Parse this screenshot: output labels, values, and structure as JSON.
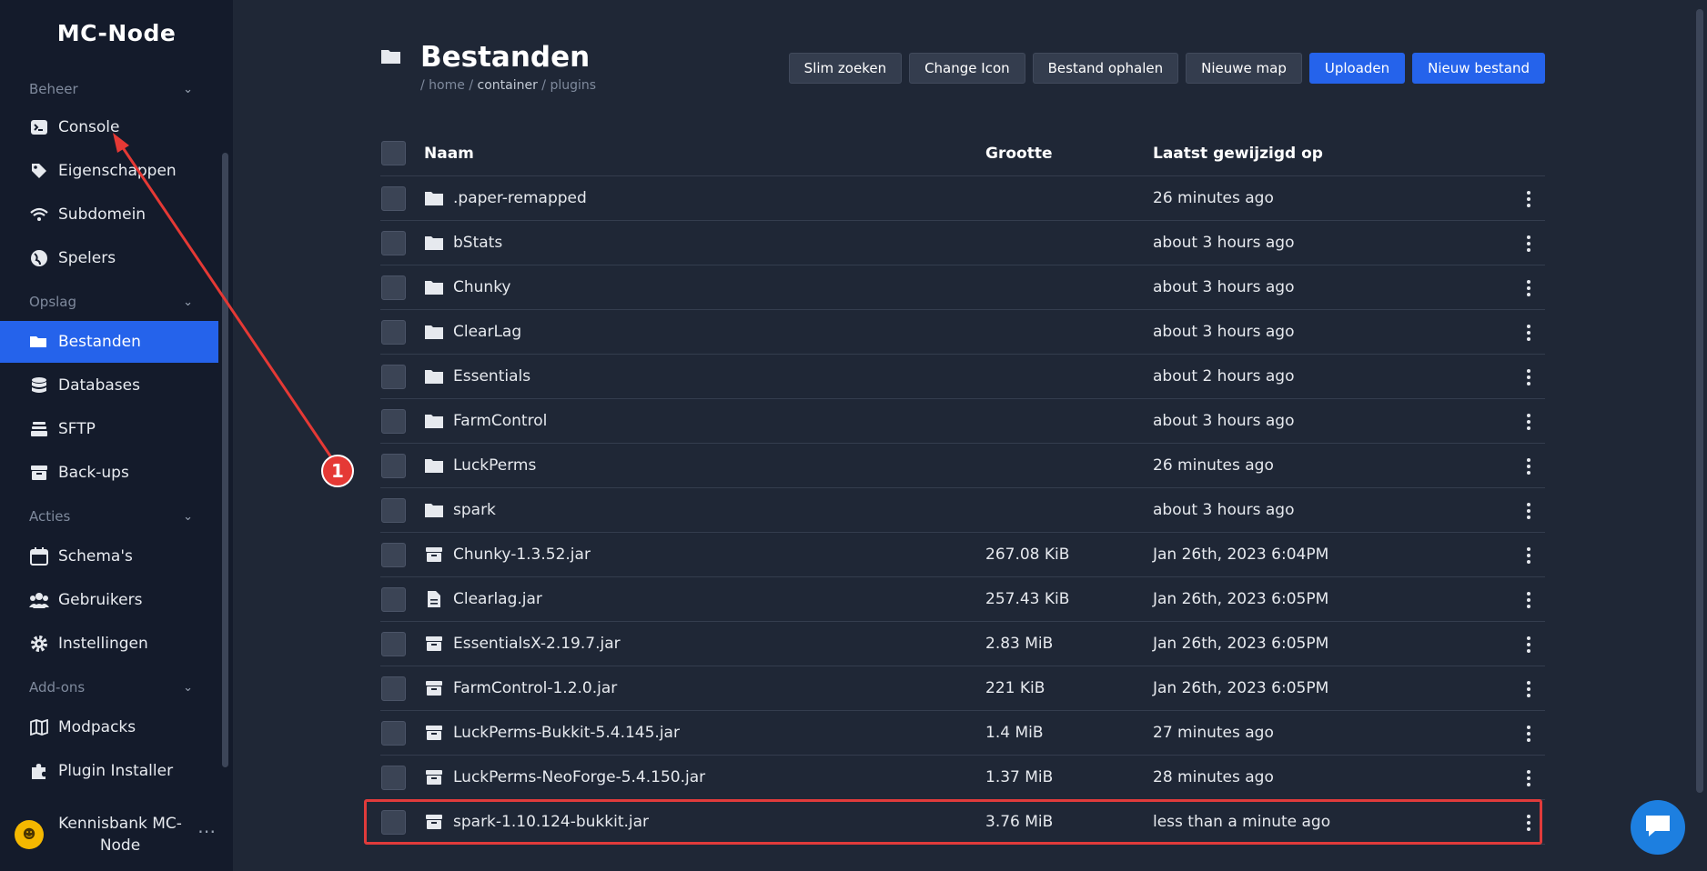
{
  "app": {
    "brand": "MC-Node"
  },
  "sidebar": {
    "sections": [
      {
        "label": "Beheer"
      },
      {
        "label": "Opslag"
      },
      {
        "label": "Acties"
      },
      {
        "label": "Add-ons"
      }
    ],
    "items": [
      {
        "label": "Console",
        "icon": "terminal-icon"
      },
      {
        "label": "Eigenschappen",
        "icon": "tag-icon"
      },
      {
        "label": "Subdomein",
        "icon": "wifi-icon"
      },
      {
        "label": "Spelers",
        "icon": "globe-icon"
      },
      {
        "label": "Bestanden",
        "icon": "folder-open-icon",
        "active": true
      },
      {
        "label": "Databases",
        "icon": "database-icon"
      },
      {
        "label": "SFTP",
        "icon": "layers-icon"
      },
      {
        "label": "Back-ups",
        "icon": "archive-icon"
      },
      {
        "label": "Schema's",
        "icon": "calendar-icon"
      },
      {
        "label": "Gebruikers",
        "icon": "users-icon"
      },
      {
        "label": "Instellingen",
        "icon": "gear-icon"
      },
      {
        "label": "Modpacks",
        "icon": "map-icon"
      },
      {
        "label": "Plugin Installer",
        "icon": "puzzle-icon"
      }
    ],
    "user": {
      "name": "Kennisbank MC-Node"
    }
  },
  "header": {
    "title": "Bestanden",
    "breadcrumb": {
      "sep1": "/",
      "home": "home",
      "sep2": "/",
      "container": "container",
      "sep3": "/",
      "plugins": "plugins"
    },
    "buttons": {
      "smart_search": "Slim zoeken",
      "change_icon": "Change Icon",
      "fetch_file": "Bestand ophalen",
      "new_folder": "Nieuwe map",
      "upload": "Uploaden",
      "new_file": "Nieuw bestand"
    }
  },
  "table": {
    "columns": {
      "name": "Naam",
      "size": "Grootte",
      "modified": "Laatst gewijzigd op"
    },
    "rows": [
      {
        "name": ".paper-remapped",
        "type": "folder",
        "size": "",
        "modified": "26 minutes ago"
      },
      {
        "name": "bStats",
        "type": "folder",
        "size": "",
        "modified": "about 3 hours ago"
      },
      {
        "name": "Chunky",
        "type": "folder",
        "size": "",
        "modified": "about 3 hours ago"
      },
      {
        "name": "ClearLag",
        "type": "folder",
        "size": "",
        "modified": "about 3 hours ago"
      },
      {
        "name": "Essentials",
        "type": "folder",
        "size": "",
        "modified": "about 2 hours ago"
      },
      {
        "name": "FarmControl",
        "type": "folder",
        "size": "",
        "modified": "about 3 hours ago"
      },
      {
        "name": "LuckPerms",
        "type": "folder",
        "size": "",
        "modified": "26 minutes ago"
      },
      {
        "name": "spark",
        "type": "folder",
        "size": "",
        "modified": "about 3 hours ago"
      },
      {
        "name": "Chunky-1.3.52.jar",
        "type": "archive",
        "size": "267.08 KiB",
        "modified": "Jan 26th, 2023 6:04PM"
      },
      {
        "name": "Clearlag.jar",
        "type": "file",
        "size": "257.43 KiB",
        "modified": "Jan 26th, 2023 6:05PM"
      },
      {
        "name": "EssentialsX-2.19.7.jar",
        "type": "archive",
        "size": "2.83 MiB",
        "modified": "Jan 26th, 2023 6:05PM"
      },
      {
        "name": "FarmControl-1.2.0.jar",
        "type": "archive",
        "size": "221 KiB",
        "modified": "Jan 26th, 2023 6:05PM"
      },
      {
        "name": "LuckPerms-Bukkit-5.4.145.jar",
        "type": "archive",
        "size": "1.4 MiB",
        "modified": "27 minutes ago"
      },
      {
        "name": "LuckPerms-NeoForge-5.4.150.jar",
        "type": "archive",
        "size": "1.37 MiB",
        "modified": "28 minutes ago"
      },
      {
        "name": "spark-1.10.124-bukkit.jar",
        "type": "archive",
        "size": "3.76 MiB",
        "modified": "less than a minute ago",
        "highlighted": true
      }
    ]
  },
  "annotation": {
    "badge": "1"
  },
  "colors": {
    "accent": "#2563eb",
    "sidebar_bg": "#141b2b",
    "main_bg": "#1f2736",
    "annotation": "#e53935"
  }
}
